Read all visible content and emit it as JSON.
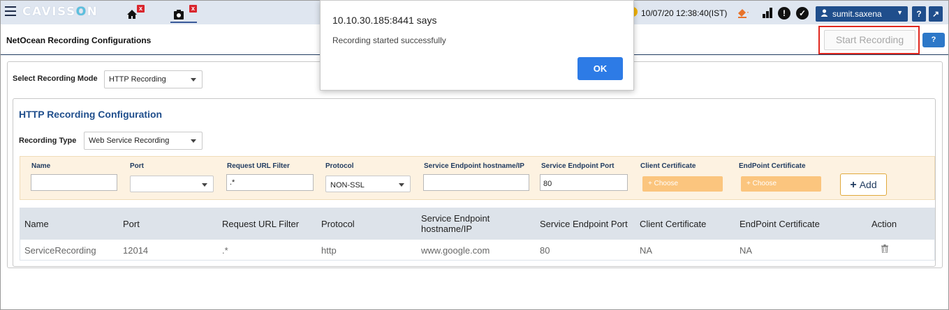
{
  "app": {
    "logo_prefix": "CAVISS",
    "logo_o": "O",
    "logo_suffix": "N",
    "datetime": "10/07/20 12:38:40(IST)",
    "user_name": "sumit.saxena",
    "tabs": [
      {
        "icon": "home-icon",
        "close": "x"
      },
      {
        "icon": "recording-icon",
        "close": "x"
      }
    ],
    "help_label": "?",
    "expand_label": "↗"
  },
  "page": {
    "title": "NetOcean Recording Configurations",
    "start_recording_label": "Start Recording",
    "help_label": "?"
  },
  "mode": {
    "label": "Select Recording Mode",
    "selected": "HTTP Recording"
  },
  "config": {
    "title": "HTTP Recording Configuration",
    "type_label": "Recording Type",
    "type_selected": "Web Service Recording",
    "fields": {
      "name_label": "Name",
      "name_value": "",
      "port_label": "Port",
      "port_value": "",
      "url_filter_label": "Request URL Filter",
      "url_filter_value": ".*",
      "protocol_label": "Protocol",
      "protocol_value": "NON-SSL",
      "endpoint_host_label": "Service Endpoint hostname/IP",
      "endpoint_host_value": "",
      "endpoint_port_label": "Service Endpoint Port",
      "endpoint_port_value": "80",
      "client_cert_label": "Client Certificate",
      "client_cert_button": "+ Choose",
      "endpoint_cert_label": "EndPoint Certificate",
      "endpoint_cert_button": "+ Choose",
      "add_label": "Add",
      "add_plus": "+"
    }
  },
  "table": {
    "headers": {
      "name": "Name",
      "port": "Port",
      "url_filter": "Request URL Filter",
      "protocol": "Protocol",
      "endpoint_host_1": "Service Endpoint",
      "endpoint_host_2": "hostname/IP",
      "endpoint_port": "Service Endpoint Port",
      "client_cert": "Client Certificate",
      "endpoint_cert": "EndPoint Certificate",
      "action": "Action"
    },
    "rows": [
      {
        "name": "ServiceRecording",
        "port": "12014",
        "url_filter": ".*",
        "protocol": "http",
        "endpoint_host": "www.google.com",
        "endpoint_port": "80",
        "client_cert": "NA",
        "endpoint_cert": "NA",
        "action_icon": "trash-icon"
      }
    ]
  },
  "dialog": {
    "title": "10.10.30.185:8441 says",
    "message": "Recording started successfully",
    "ok_label": "OK"
  },
  "colors": {
    "nav_blue": "#1f4e8c",
    "highlight_red": "#e0281f",
    "ok_blue": "#2d7be6",
    "input_band": "#fdf2e1",
    "choose_orange": "#fbc57e"
  }
}
